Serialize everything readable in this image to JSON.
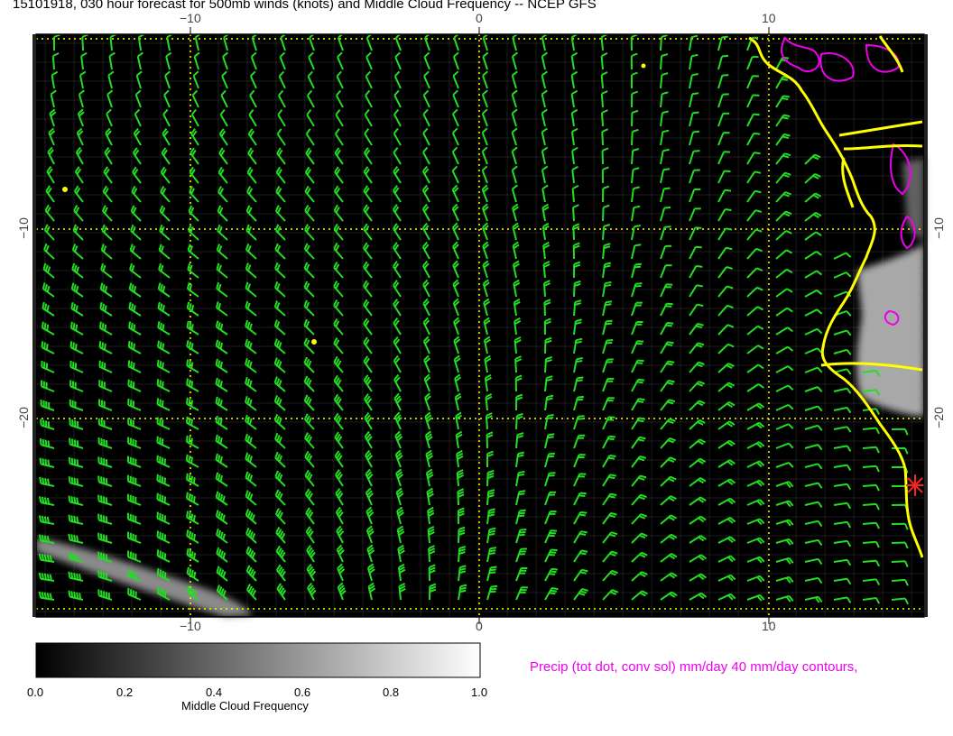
{
  "title": "15101918, 030 hour forecast for 500mb winds (knots) and Middle Cloud Frequency -- NCEP GFS",
  "axis_ticks": {
    "lon": [
      "−10",
      "0",
      "10"
    ],
    "lat": [
      "−10",
      "−20"
    ]
  },
  "colorbar": {
    "labels": [
      "0.0",
      "0.2",
      "0.4",
      "0.6",
      "0.8",
      "1.0"
    ],
    "title": "Middle Cloud Frequency"
  },
  "precip_note": "Precip (tot dot, conv sol) mm/day 40 mm/day contours,",
  "colors": {
    "wind_barb": "#22dd22",
    "coastline": "#ffff00",
    "grid": "#ffff00",
    "precip_contour": "#ee00ee",
    "marker": "#ff2222",
    "background": "#000000"
  },
  "icons": {
    "station_marker": "asterisk-marker-icon"
  }
}
